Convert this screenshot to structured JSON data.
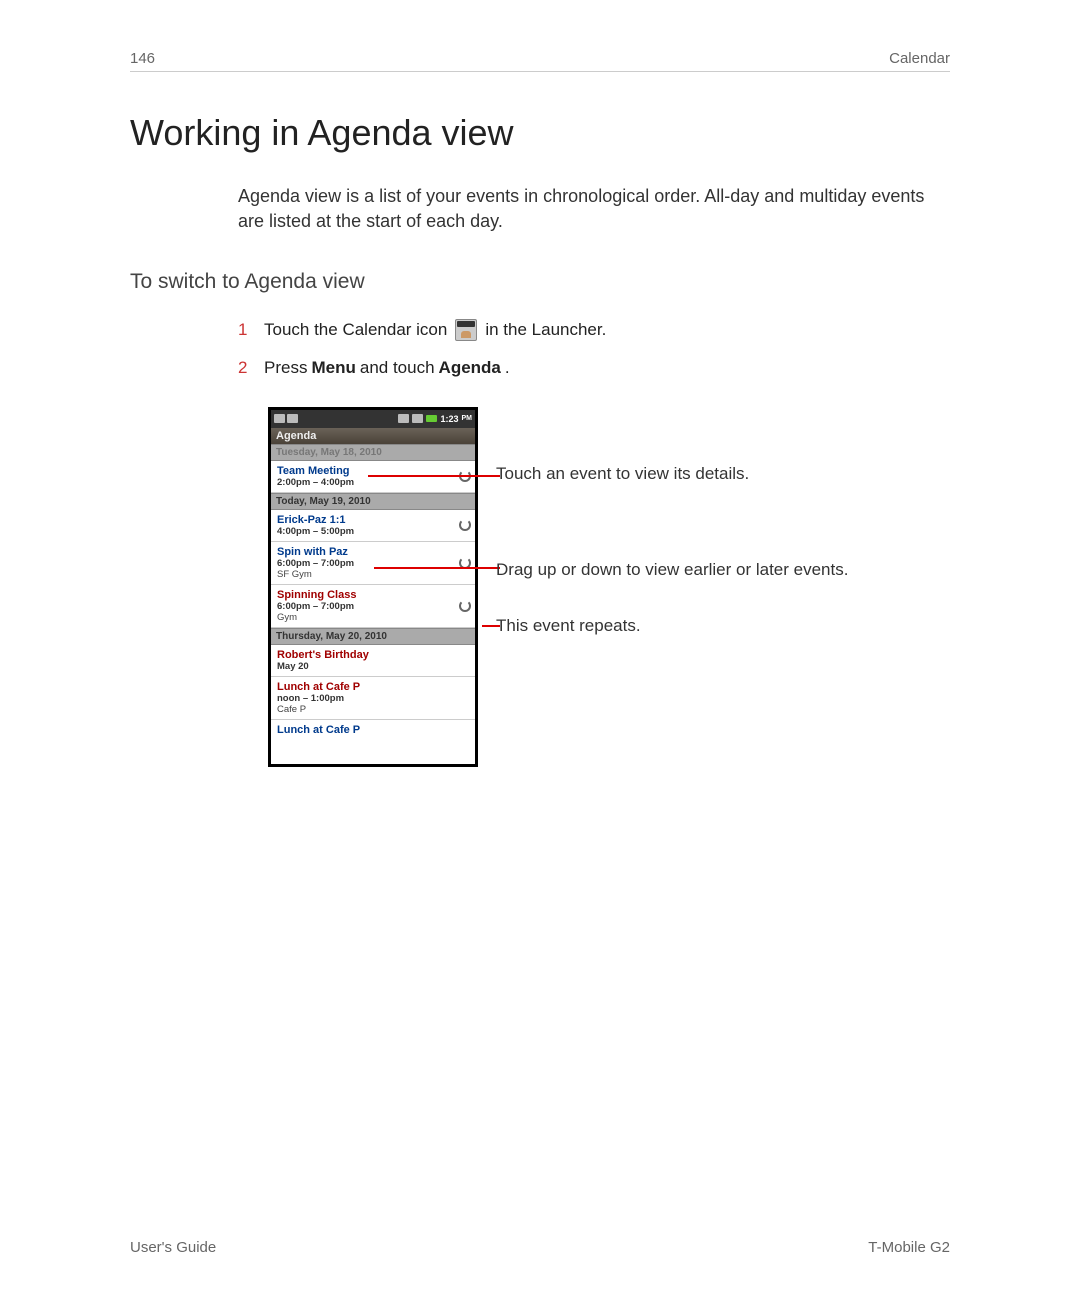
{
  "header": {
    "page_number": "146",
    "section": "Calendar"
  },
  "title": "Working in Agenda view",
  "intro": "Agenda view is a list of your events in chronological order. All-day and multiday events are listed at the start of each day.",
  "subheading": "To switch to Agenda view",
  "steps": {
    "s1_num": "1",
    "s1_a": "Touch the Calendar icon",
    "s1_b": "in the Launcher.",
    "s2_num": "2",
    "s2_a": "Press",
    "s2_menu": "Menu",
    "s2_b": "and touch",
    "s2_agenda": "Agenda",
    "s2_c": "."
  },
  "phone": {
    "time": "1:23",
    "pm": "PM",
    "app_title": "Agenda",
    "day0": "Tuesday, May 18, 2010",
    "day1": "Today, May 19, 2010",
    "day2": "Thursday, May 20, 2010",
    "events": {
      "e1": {
        "title": "Team Meeting",
        "time": "2:00pm – 4:00pm"
      },
      "e2": {
        "title": "Erick-Paz 1:1",
        "time": "4:00pm – 5:00pm"
      },
      "e3": {
        "title": "Spin with Paz",
        "time": "6:00pm – 7:00pm",
        "loc": "SF Gym"
      },
      "e4": {
        "title": "Spinning Class",
        "time": "6:00pm – 7:00pm",
        "loc": "Gym"
      },
      "e5": {
        "title": "Robert's Birthday",
        "time": "May 20"
      },
      "e6": {
        "title": "Lunch at Cafe P",
        "time": "noon – 1:00pm",
        "loc": "Cafe P"
      },
      "e7": {
        "title": "Lunch at Cafe P"
      }
    }
  },
  "callouts": {
    "c1": "Touch an event to view its details.",
    "c2": "Drag up or down to view earlier or later events.",
    "c3": "This event repeats."
  },
  "footer": {
    "left": "User's Guide",
    "right": "T-Mobile G2"
  }
}
